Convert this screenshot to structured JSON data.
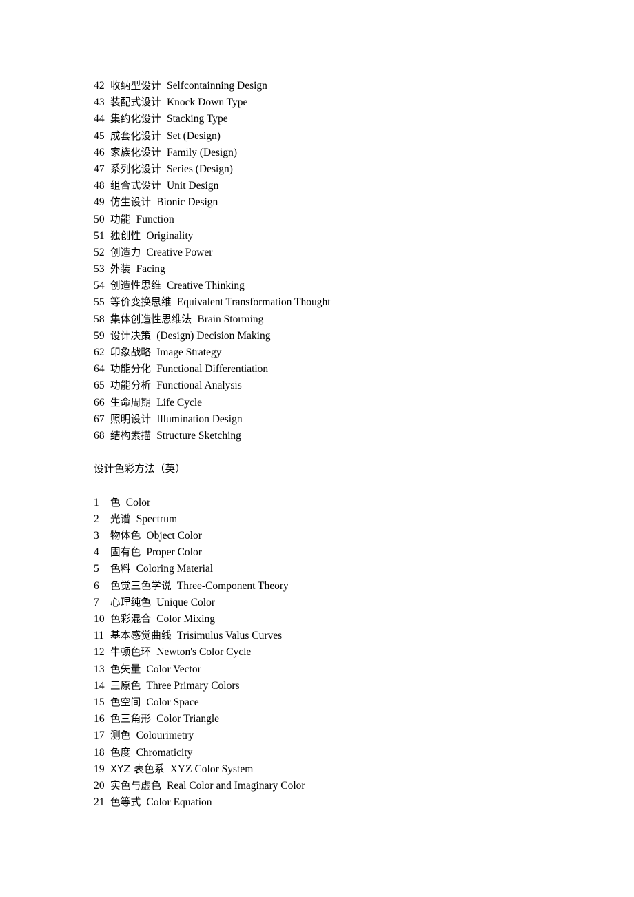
{
  "document": {
    "background_color": "#ffffff",
    "text_color": "#000000"
  },
  "sections": [
    {
      "heading": null,
      "entries": [
        {
          "num": "42",
          "zh": "收纳型设计",
          "en": "Selfcontainning Design"
        },
        {
          "num": "43",
          "zh": "装配式设计",
          "en": "Knock Down Type"
        },
        {
          "num": "44",
          "zh": "集约化设计",
          "en": "Stacking Type"
        },
        {
          "num": "45",
          "zh": "成套化设计",
          "en": "Set (Design)"
        },
        {
          "num": "46",
          "zh": "家族化设计",
          "en": "Family (Design)"
        },
        {
          "num": "47",
          "zh": "系列化设计",
          "en": "Series (Design)"
        },
        {
          "num": "48",
          "zh": "组合式设计",
          "en": "Unit Design"
        },
        {
          "num": "49",
          "zh": "仿生设计",
          "en": "Bionic Design"
        },
        {
          "num": "50",
          "zh": "功能",
          "en": "Function"
        },
        {
          "num": "51",
          "zh": "独创性",
          "en": "Originality"
        },
        {
          "num": "52",
          "zh": "创造力",
          "en": "Creative Power"
        },
        {
          "num": "53",
          "zh": "外装",
          "en": "Facing"
        },
        {
          "num": "54",
          "zh": "创造性思维",
          "en": "Creative Thinking"
        },
        {
          "num": "55",
          "zh": "等价变换思维",
          "en": "Equivalent Transformation Thought"
        },
        {
          "num": "58",
          "zh": "集体创造性思维法",
          "en": "Brain Storming"
        },
        {
          "num": "59",
          "zh": "设计决策",
          "en": "(Design) Decision Making"
        },
        {
          "num": "62",
          "zh": "印象战略",
          "en": "Image Strategy"
        },
        {
          "num": "64",
          "zh": "功能分化",
          "en": "Functional Differentiation"
        },
        {
          "num": "65",
          "zh": "功能分析",
          "en": "Functional Analysis"
        },
        {
          "num": "66",
          "zh": "生命周期",
          "en": "Life Cycle"
        },
        {
          "num": "67",
          "zh": "照明设计",
          "en": "Illumination Design"
        },
        {
          "num": "68",
          "zh": "结构素描",
          "en": "Structure Sketching"
        }
      ]
    },
    {
      "heading": "设计色彩方法（英）",
      "entries": [
        {
          "num": "1",
          "zh": "色",
          "en": "Color"
        },
        {
          "num": "2",
          "zh": "光谱",
          "en": "Spectrum"
        },
        {
          "num": "3",
          "zh": "物体色",
          "en": "Object Color"
        },
        {
          "num": "4",
          "zh": "固有色",
          "en": "Proper Color"
        },
        {
          "num": "5",
          "zh": "色料",
          "en": "Coloring Material"
        },
        {
          "num": "6",
          "zh": "色觉三色学说",
          "en": "Three-Component Theory"
        },
        {
          "num": "7",
          "zh": "心理纯色",
          "en": "Unique Color"
        },
        {
          "num": "10",
          "zh": "色彩混合",
          "en": "Color Mixing"
        },
        {
          "num": "11",
          "zh": "基本感觉曲线",
          "en": "Trisimulus Valus Curves"
        },
        {
          "num": "12",
          "zh": "牛顿色环",
          "en": "Newton's Color Cycle"
        },
        {
          "num": "13",
          "zh": "色矢量",
          "en": "Color Vector"
        },
        {
          "num": "14",
          "zh": "三原色",
          "en": "Three Primary Colors"
        },
        {
          "num": "15",
          "zh": "色空间",
          "en": "Color Space"
        },
        {
          "num": "16",
          "zh": "色三角形",
          "en": "Color Triangle"
        },
        {
          "num": "17",
          "zh": "测色",
          "en": "Colourimetry"
        },
        {
          "num": "18",
          "zh": "色度",
          "en": "Chromaticity"
        },
        {
          "num": "19",
          "zh": "XYZ 表色系",
          "en": "XYZ Color System"
        },
        {
          "num": "20",
          "zh": "实色与虚色",
          "en": "Real Color and Imaginary Color"
        },
        {
          "num": "21",
          "zh": "色等式",
          "en": "Color Equation"
        }
      ]
    }
  ]
}
